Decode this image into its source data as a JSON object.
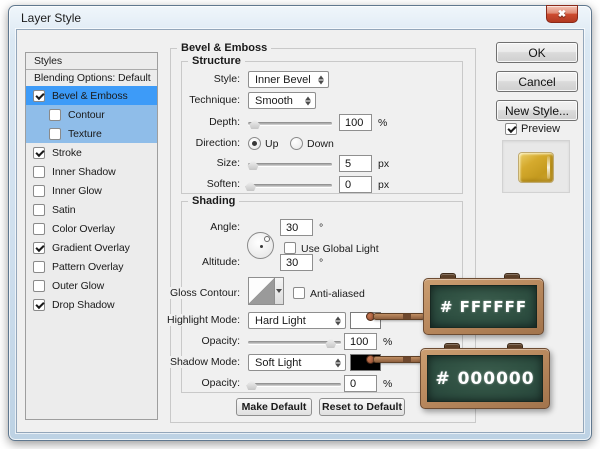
{
  "window": {
    "title": "Layer Style"
  },
  "icons": {
    "close_glyph": "✖"
  },
  "sidebar": {
    "header": "Styles",
    "items": [
      {
        "label": "Blending Options: Default",
        "has_checkbox": false,
        "checked": false
      },
      {
        "label": "Bevel & Emboss",
        "has_checkbox": true,
        "checked": true
      },
      {
        "label": "Contour",
        "has_checkbox": true,
        "checked": false
      },
      {
        "label": "Texture",
        "has_checkbox": true,
        "checked": false
      },
      {
        "label": "Stroke",
        "has_checkbox": true,
        "checked": true
      },
      {
        "label": "Inner Shadow",
        "has_checkbox": true,
        "checked": false
      },
      {
        "label": "Inner Glow",
        "has_checkbox": true,
        "checked": false
      },
      {
        "label": "Satin",
        "has_checkbox": true,
        "checked": false
      },
      {
        "label": "Color Overlay",
        "has_checkbox": true,
        "checked": false
      },
      {
        "label": "Gradient Overlay",
        "has_checkbox": true,
        "checked": true
      },
      {
        "label": "Pattern Overlay",
        "has_checkbox": true,
        "checked": false
      },
      {
        "label": "Outer Glow",
        "has_checkbox": true,
        "checked": false
      },
      {
        "label": "Drop Shadow",
        "has_checkbox": true,
        "checked": true
      }
    ]
  },
  "panel": {
    "group_title": "Bevel & Emboss",
    "structure": {
      "title": "Structure",
      "style_label": "Style:",
      "style_value": "Inner Bevel",
      "technique_label": "Technique:",
      "technique_value": "Smooth",
      "depth_label": "Depth:",
      "depth_value": "100",
      "depth_unit": "%",
      "direction_label": "Direction:",
      "up_label": "Up",
      "down_label": "Down",
      "up_selected": true,
      "down_selected": false,
      "size_label": "Size:",
      "size_value": "5",
      "size_unit": "px",
      "soften_label": "Soften:",
      "soften_value": "0",
      "soften_unit": "px"
    },
    "shading": {
      "title": "Shading",
      "angle_label": "Angle:",
      "angle_value": "30",
      "angle_unit": "°",
      "use_global_light_label": "Use Global Light",
      "use_global_light_checked": false,
      "altitude_label": "Altitude:",
      "altitude_value": "30",
      "altitude_unit": "°",
      "gloss_contour_label": "Gloss Contour:",
      "anti_aliased_label": "Anti-aliased",
      "anti_aliased_checked": false,
      "highlight_mode_label": "Highlight Mode:",
      "highlight_mode_value": "Hard Light",
      "highlight_color": "#FFFFFF",
      "highlight_opacity_label": "Opacity:",
      "highlight_opacity_value": "100",
      "highlight_opacity_unit": "%",
      "shadow_mode_label": "Shadow Mode:",
      "shadow_mode_value": "Soft Light",
      "shadow_color": "#000000",
      "shadow_opacity_label": "Opacity:",
      "shadow_opacity_value": "0",
      "shadow_opacity_unit": "%"
    },
    "footer_buttons": {
      "make_default": "Make Default",
      "reset_to_default": "Reset to Default"
    }
  },
  "actions": {
    "ok": "OK",
    "cancel": "Cancel",
    "new_style": "New Style...",
    "preview_label": "Preview",
    "preview_checked": true
  },
  "overlays": {
    "highlight_hex": "# FFFFFF",
    "shadow_hex": "# 000000"
  },
  "colors": {
    "selection_blue": "#3d9bf8",
    "sub_selection_blue": "#8fbde9",
    "dialog_background": "#f0f0f0",
    "chalkboard_green": "#2f5243",
    "wood_frame": "#b8885d",
    "preview_gold": "#d5aa2d",
    "highlight_swatch": "#FFFFFF",
    "shadow_swatch": "#000000"
  }
}
